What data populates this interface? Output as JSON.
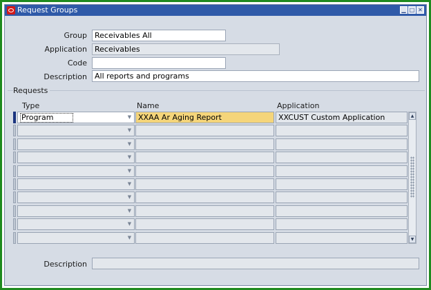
{
  "window": {
    "title": "Request Groups",
    "minimize_glyph": "▁",
    "maximize_glyph": "□",
    "close_glyph": "✕"
  },
  "header": {
    "group_label": "Group",
    "group_value": "Receivables All",
    "application_label": "Application",
    "application_value": "Receivables",
    "code_label": "Code",
    "code_value": "",
    "description_label": "Description",
    "description_value": "All reports and programs"
  },
  "requests": {
    "section_label": "Requests",
    "columns": {
      "type": "Type",
      "name": "Name",
      "application": "Application"
    },
    "rows": [
      {
        "type": "Program",
        "name": "XXAA Ar Aging Report",
        "application": "XXCUST Custom Application"
      },
      {
        "type": "",
        "name": "",
        "application": ""
      },
      {
        "type": "",
        "name": "",
        "application": ""
      },
      {
        "type": "",
        "name": "",
        "application": ""
      },
      {
        "type": "",
        "name": "",
        "application": ""
      },
      {
        "type": "",
        "name": "",
        "application": ""
      },
      {
        "type": "",
        "name": "",
        "application": ""
      },
      {
        "type": "",
        "name": "",
        "application": ""
      },
      {
        "type": "",
        "name": "",
        "application": ""
      },
      {
        "type": "",
        "name": "",
        "application": ""
      }
    ]
  },
  "footer": {
    "description_label": "Description",
    "description_value": ""
  },
  "icons": {
    "logo": "oracle-logo-icon",
    "dropdown": "chevron-down-icon",
    "scroll_up": "scroll-up-icon",
    "scroll_down": "scroll-down-icon"
  },
  "colors": {
    "frame": "#1f8a1f",
    "titlebar": "#2f5aa8",
    "form_background": "#d6dce5",
    "active_row": "#f5d57a",
    "current_record_indicator": "#1c3580"
  }
}
